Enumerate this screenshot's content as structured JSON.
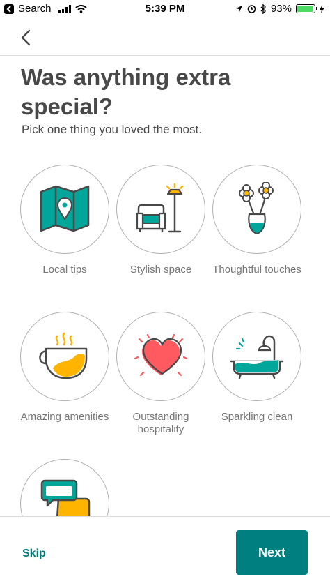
{
  "status_bar": {
    "back_app": "Search",
    "time": "5:39 PM",
    "battery": "93%",
    "battery_level": 0.93,
    "icons": [
      "back-app-icon",
      "signal-icon",
      "wifi-icon",
      "location-icon",
      "alarm-icon",
      "bluetooth-icon",
      "battery-icon",
      "charging-icon"
    ]
  },
  "nav": {
    "back_icon": "chevron-left-icon"
  },
  "header": {
    "title": "Was anything extra special?",
    "subtitle": "Pick one thing you loved the most."
  },
  "options": [
    {
      "label": "Local tips",
      "icon": "map-icon"
    },
    {
      "label": "Stylish space",
      "icon": "armchair-lamp-icon"
    },
    {
      "label": "Thoughtful touches",
      "icon": "flowers-vase-icon"
    },
    {
      "label": "Amazing amenities",
      "icon": "coffee-cup-icon"
    },
    {
      "label": "Outstanding hospitality",
      "icon": "heart-icon"
    },
    {
      "label": "Sparkling clean",
      "icon": "bathtub-icon"
    },
    {
      "label": "",
      "icon": "chat-bubbles-icon"
    }
  ],
  "footer": {
    "skip_label": "Skip",
    "next_label": "Next"
  },
  "colors": {
    "teal": "#00A699",
    "yellow": "#FFB400",
    "coral": "#FF5A5F",
    "accent": "#007F80",
    "text": "#484848"
  }
}
